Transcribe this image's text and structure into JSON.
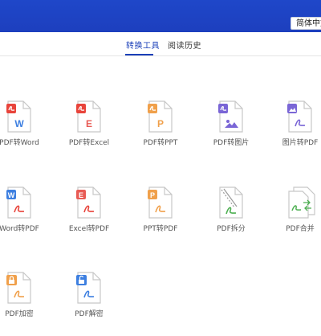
{
  "header": {
    "language_label": "简体中文"
  },
  "tabs": [
    {
      "label": "转换工具",
      "active": true
    },
    {
      "label": "阅读历史",
      "active": false
    }
  ],
  "colors": {
    "header_blue": "#1f47c9",
    "accent": "#1a3fb8",
    "pdf_red": "#e8443b",
    "word_blue": "#3d7fe0",
    "excel_red": "#e85b55",
    "ppt_orange": "#f0a04b",
    "image_purple": "#7a66d6",
    "merge_green": "#4caf50"
  },
  "tools": [
    {
      "label": "PDF转Word",
      "icon": "pdf-to-word-icon"
    },
    {
      "label": "PDF转Excel",
      "icon": "pdf-to-excel-icon"
    },
    {
      "label": "PDF转PPT",
      "icon": "pdf-to-ppt-icon"
    },
    {
      "label": "PDF转图片",
      "icon": "pdf-to-image-icon"
    },
    {
      "label": "图片转PDF",
      "icon": "image-to-pdf-icon"
    },
    {
      "label": "Word转PDF",
      "icon": "word-to-pdf-icon"
    },
    {
      "label": "Excel转PDF",
      "icon": "excel-to-pdf-icon"
    },
    {
      "label": "PPT转PDF",
      "icon": "ppt-to-pdf-icon"
    },
    {
      "label": "PDF拆分",
      "icon": "pdf-split-icon"
    },
    {
      "label": "PDF合并",
      "icon": "pdf-merge-icon"
    },
    {
      "label": "PDF加密",
      "icon": "pdf-encrypt-icon"
    },
    {
      "label": "PDF解密",
      "icon": "pdf-decrypt-icon"
    }
  ]
}
